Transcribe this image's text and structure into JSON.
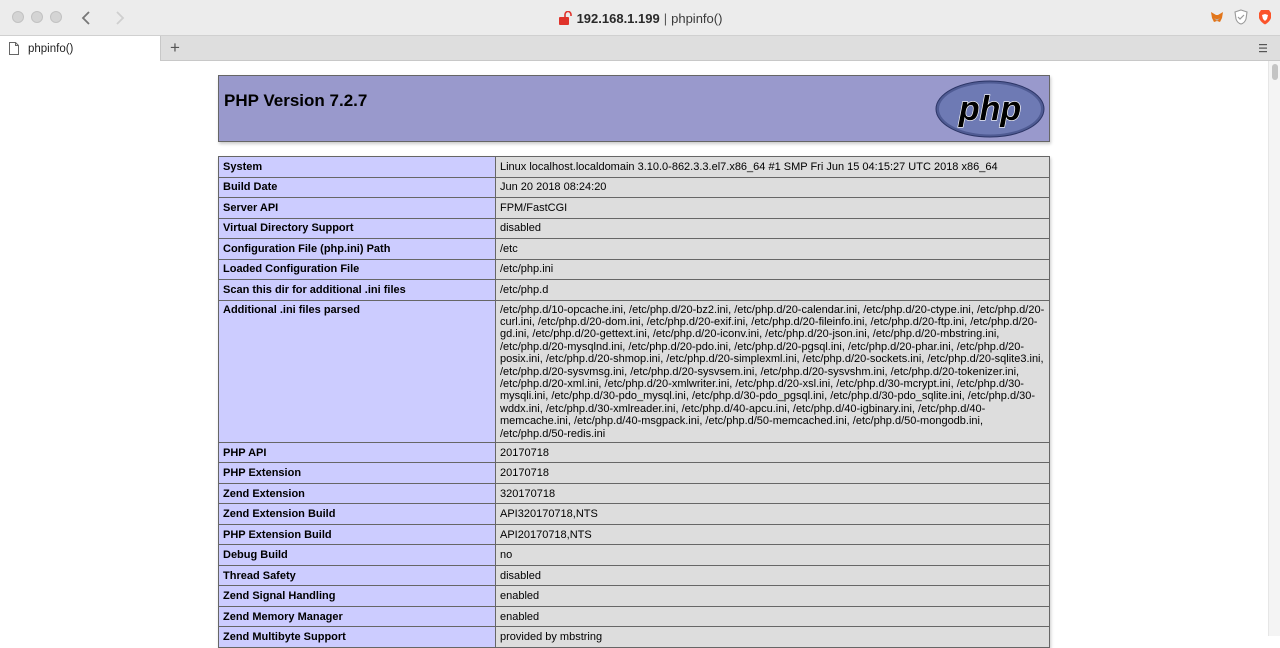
{
  "browser": {
    "host": "192.168.1.199",
    "separator": "|",
    "page_title": "phpinfo()",
    "tab_label": "phpinfo()",
    "new_tab_label": "+",
    "back_glyph": "‹",
    "forward_glyph": "›"
  },
  "php": {
    "version_heading": "PHP Version 7.2.7",
    "logo_text": "php",
    "rows": [
      {
        "key": "System",
        "value": "Linux localhost.localdomain 3.10.0-862.3.3.el7.x86_64 #1 SMP Fri Jun 15 04:15:27 UTC 2018 x86_64"
      },
      {
        "key": "Build Date",
        "value": "Jun 20 2018 08:24:20"
      },
      {
        "key": "Server API",
        "value": "FPM/FastCGI"
      },
      {
        "key": "Virtual Directory Support",
        "value": "disabled"
      },
      {
        "key": "Configuration File (php.ini) Path",
        "value": "/etc"
      },
      {
        "key": "Loaded Configuration File",
        "value": "/etc/php.ini"
      },
      {
        "key": "Scan this dir for additional .ini files",
        "value": "/etc/php.d"
      },
      {
        "key": "Additional .ini files parsed",
        "value": "/etc/php.d/10-opcache.ini, /etc/php.d/20-bz2.ini, /etc/php.d/20-calendar.ini, /etc/php.d/20-ctype.ini, /etc/php.d/20-curl.ini, /etc/php.d/20-dom.ini, /etc/php.d/20-exif.ini, /etc/php.d/20-fileinfo.ini, /etc/php.d/20-ftp.ini, /etc/php.d/20-gd.ini, /etc/php.d/20-gettext.ini, /etc/php.d/20-iconv.ini, /etc/php.d/20-json.ini, /etc/php.d/20-mbstring.ini, /etc/php.d/20-mysqlnd.ini, /etc/php.d/20-pdo.ini, /etc/php.d/20-pgsql.ini, /etc/php.d/20-phar.ini, /etc/php.d/20-posix.ini, /etc/php.d/20-shmop.ini, /etc/php.d/20-simplexml.ini, /etc/php.d/20-sockets.ini, /etc/php.d/20-sqlite3.ini, /etc/php.d/20-sysvmsg.ini, /etc/php.d/20-sysvsem.ini, /etc/php.d/20-sysvshm.ini, /etc/php.d/20-tokenizer.ini, /etc/php.d/20-xml.ini, /etc/php.d/20-xmlwriter.ini, /etc/php.d/20-xsl.ini, /etc/php.d/30-mcrypt.ini, /etc/php.d/30-mysqli.ini, /etc/php.d/30-pdo_mysql.ini, /etc/php.d/30-pdo_pgsql.ini, /etc/php.d/30-pdo_sqlite.ini, /etc/php.d/30-wddx.ini, /etc/php.d/30-xmlreader.ini, /etc/php.d/40-apcu.ini, /etc/php.d/40-igbinary.ini, /etc/php.d/40-memcache.ini, /etc/php.d/40-msgpack.ini, /etc/php.d/50-memcached.ini, /etc/php.d/50-mongodb.ini, /etc/php.d/50-redis.ini"
      },
      {
        "key": "PHP API",
        "value": "20170718"
      },
      {
        "key": "PHP Extension",
        "value": "20170718"
      },
      {
        "key": "Zend Extension",
        "value": "320170718"
      },
      {
        "key": "Zend Extension Build",
        "value": "API320170718,NTS"
      },
      {
        "key": "PHP Extension Build",
        "value": "API20170718,NTS"
      },
      {
        "key": "Debug Build",
        "value": "no"
      },
      {
        "key": "Thread Safety",
        "value": "disabled"
      },
      {
        "key": "Zend Signal Handling",
        "value": "enabled"
      },
      {
        "key": "Zend Memory Manager",
        "value": "enabled"
      },
      {
        "key": "Zend Multibyte Support",
        "value": "provided by mbstring"
      }
    ]
  },
  "colors": {
    "header_bg": "#9999cc",
    "key_cell_bg": "#ccccff",
    "value_cell_bg": "#dddddd",
    "lock_red": "#e0332b",
    "brave_orange": "#fb542b"
  },
  "icons": {
    "lock": "lock-icon",
    "file": "file-icon",
    "metamask": "metamask-icon",
    "shield": "shield-icon",
    "brave": "brave-lion-icon",
    "menu": "tab-menu-icon"
  }
}
